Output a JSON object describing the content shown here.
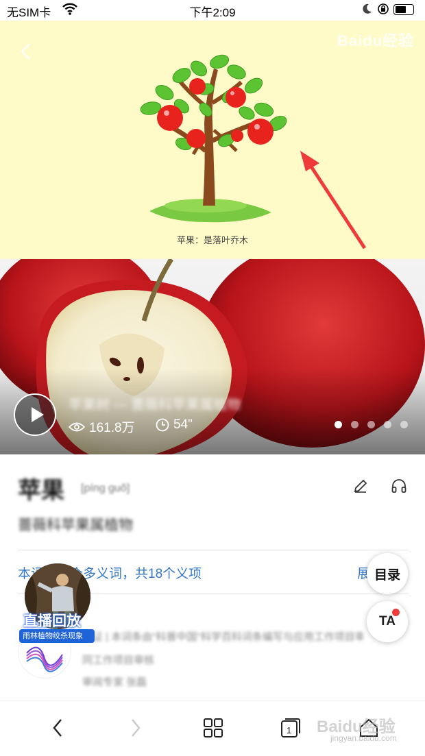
{
  "status_bar": {
    "carrier": "无SIM卡",
    "time": "下午2:09"
  },
  "hero": {
    "caption": "苹果：是落叶乔木",
    "watermark": "Baidu经验"
  },
  "video": {
    "title": "苹果树 — 蔷薇科苹果属植物",
    "views": "161.8万",
    "duration": "54\"",
    "carousel_pages": 5,
    "active_page": 1
  },
  "entry": {
    "title": "苹果",
    "pinyin": "[píng guǒ]",
    "subtitle": "蔷薇科苹果属植物",
    "polysemy": "本词是一个多义词，共18个义项",
    "expand": "展开"
  },
  "float_buttons": {
    "toc": "目录",
    "ta": "TA"
  },
  "live": {
    "label": "直播回放",
    "sub": "雨林植物绞杀现象"
  },
  "author": {
    "line1": "认证 | 本词条由\"科普中国\"科学百科词条编写与应用工作项目审核",
    "line2": "同工作项目审核",
    "line3": "审阅专家 张磊"
  },
  "bottom_watermark": {
    "main": "Baidu经验",
    "sub": "jingyan.baidu.com"
  },
  "colors": {
    "hero_bg": "#fffbc8",
    "link_blue": "#3478c7",
    "live_blue": "#1f63d8",
    "badge_red": "#ee3b3b"
  }
}
